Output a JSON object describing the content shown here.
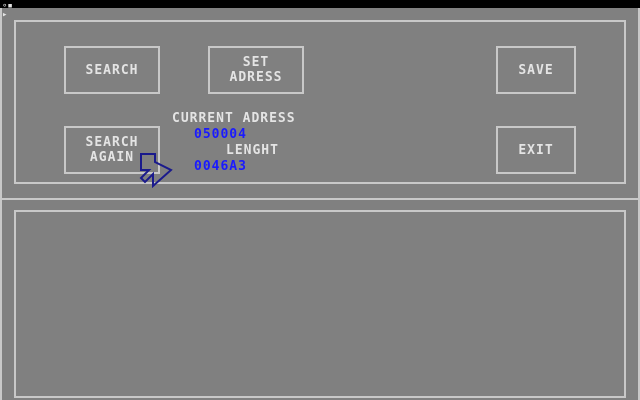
{
  "buttons": {
    "search": "SEARCH",
    "set_address": "SET\nADRESS",
    "save": "SAVE",
    "search_again": "SEARCH\nAGAIN",
    "exit": "EXIT"
  },
  "info": {
    "current_address_label": "CURRENT ADRESS",
    "current_address_value": "050004",
    "length_label": "LENGHT",
    "length_value": "0046A3"
  },
  "icons": {
    "pointer": "arrow-pointer-icon",
    "corner": "corner-marker-icon"
  },
  "colors": {
    "background": "#808080",
    "border": "#c8c8c8",
    "text": "#e4e4e4",
    "value": "#1a1aff",
    "pointer": "#1a1a8c"
  }
}
